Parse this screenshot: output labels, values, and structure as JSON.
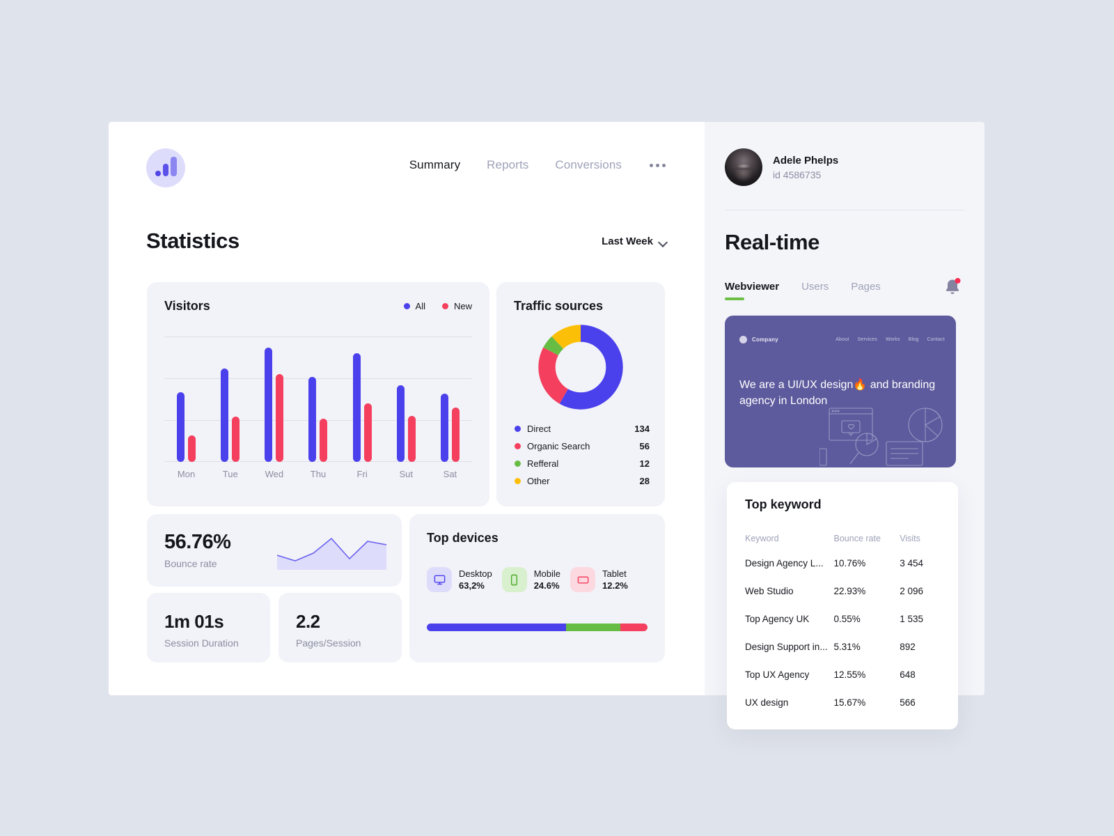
{
  "nav": {
    "logo": "analytics-logo",
    "items": [
      {
        "label": "Summary",
        "active": true
      },
      {
        "label": "Reports",
        "active": false
      },
      {
        "label": "Conversions",
        "active": false
      }
    ],
    "more": "more-options"
  },
  "statistics": {
    "title": "Statistics",
    "period": "Last Week"
  },
  "visitors": {
    "title": "Visitors",
    "legend": [
      {
        "label": "All",
        "color": "#4b41ec"
      },
      {
        "label": "New",
        "color": "#f43f5e"
      }
    ]
  },
  "traffic": {
    "title": "Traffic sources",
    "sources": [
      {
        "label": "Direct",
        "value": "134",
        "color": "#4b41ec"
      },
      {
        "label": "Organic Search",
        "value": "56",
        "color": "#f43f5e"
      },
      {
        "label": "Refferal",
        "value": "12",
        "color": "#67bd44"
      },
      {
        "label": "Other",
        "value": "28",
        "color": "#fcbf07"
      }
    ]
  },
  "metrics": [
    {
      "value": "56.76%",
      "label": "Bounce rate"
    },
    {
      "value": "1m 01s",
      "label": "Session Duration"
    },
    {
      "value": "2.2",
      "label": "Pages/Session"
    }
  ],
  "devices": {
    "title": "Top devices",
    "items": [
      {
        "name": "Desktop",
        "value": "63,2%",
        "icon": "monitor-icon",
        "color": "#4b41ec",
        "pct": 63.2
      },
      {
        "name": "Mobile",
        "value": "24.6%",
        "icon": "phone-icon",
        "color": "#67bd44",
        "pct": 24.6
      },
      {
        "name": "Tablet",
        "value": "12.2%",
        "icon": "tablet-icon",
        "color": "#f43f5e",
        "pct": 12.2
      }
    ]
  },
  "profile": {
    "name": "Adele Phelps",
    "id": "id 4586735",
    "notification": "bell-icon"
  },
  "realtime": {
    "title": "Real-time",
    "tabs": [
      {
        "label": "Webviewer",
        "active": true
      },
      {
        "label": "Users",
        "active": false
      },
      {
        "label": "Pages",
        "active": false
      }
    ]
  },
  "webviewer": {
    "company": "Company",
    "nav": [
      "About",
      "Services",
      "Works",
      "Blog",
      "Contact"
    ],
    "headline": "We are a UI/UX design🔥 and branding agency in London"
  },
  "keyword": {
    "title": "Top keyword",
    "columns": [
      "Keyword",
      "Bounce rate",
      "Visits"
    ],
    "rows": [
      {
        "keyword": "Design Agency L...",
        "bounce": "10.76%",
        "visits": "3 454"
      },
      {
        "keyword": "Web Studio",
        "bounce": "22.93%",
        "visits": "2 096"
      },
      {
        "keyword": "Top Agency UK",
        "bounce": "0.55%",
        "visits": "1 535"
      },
      {
        "keyword": "Design Support in...",
        "bounce": "5.31%",
        "visits": "892"
      },
      {
        "keyword": "Top UX Agency",
        "bounce": "12.55%",
        "visits": "648"
      },
      {
        "keyword": "UX design",
        "bounce": "15.67%",
        "visits": "566"
      }
    ]
  },
  "chart_data": [
    {
      "type": "bar",
      "title": "Visitors",
      "categories": [
        "Mon",
        "Tue",
        "Wed",
        "Thu",
        "Fri",
        "Sut",
        "Sat"
      ],
      "series": [
        {
          "name": "All",
          "color": "#4b41ec",
          "values": [
            100,
            134,
            164,
            122,
            156,
            110,
            98
          ]
        },
        {
          "name": "New",
          "color": "#f43f5e",
          "values": [
            38,
            65,
            126,
            62,
            84,
            66,
            78
          ]
        }
      ],
      "xlabel": "",
      "ylabel": "",
      "ylim": [
        0,
        180
      ],
      "grid": true,
      "legend": "top-right"
    },
    {
      "type": "pie",
      "title": "Traffic sources",
      "labels": [
        "Direct",
        "Organic Search",
        "Refferal",
        "Other"
      ],
      "values": [
        134,
        56,
        12,
        28
      ],
      "colors": [
        "#4b41ec",
        "#f43f5e",
        "#67bd44",
        "#fcbf07"
      ],
      "legend": "bottom",
      "donut": true
    },
    {
      "type": "area",
      "title": "Bounce rate",
      "x": [
        0,
        1,
        2,
        3,
        4,
        5,
        6
      ],
      "values": [
        46,
        32,
        50,
        92,
        40,
        84,
        76
      ],
      "colors": [
        "#6a63ef"
      ],
      "grid": false
    },
    {
      "type": "bar",
      "title": "Top devices",
      "categories": [
        "Desktop",
        "Mobile",
        "Tablet"
      ],
      "values": [
        63.2,
        24.6,
        12.2
      ],
      "colors": [
        "#4b41ec",
        "#67bd44",
        "#f43f5e"
      ],
      "ylabel": "%",
      "grid": false
    }
  ]
}
